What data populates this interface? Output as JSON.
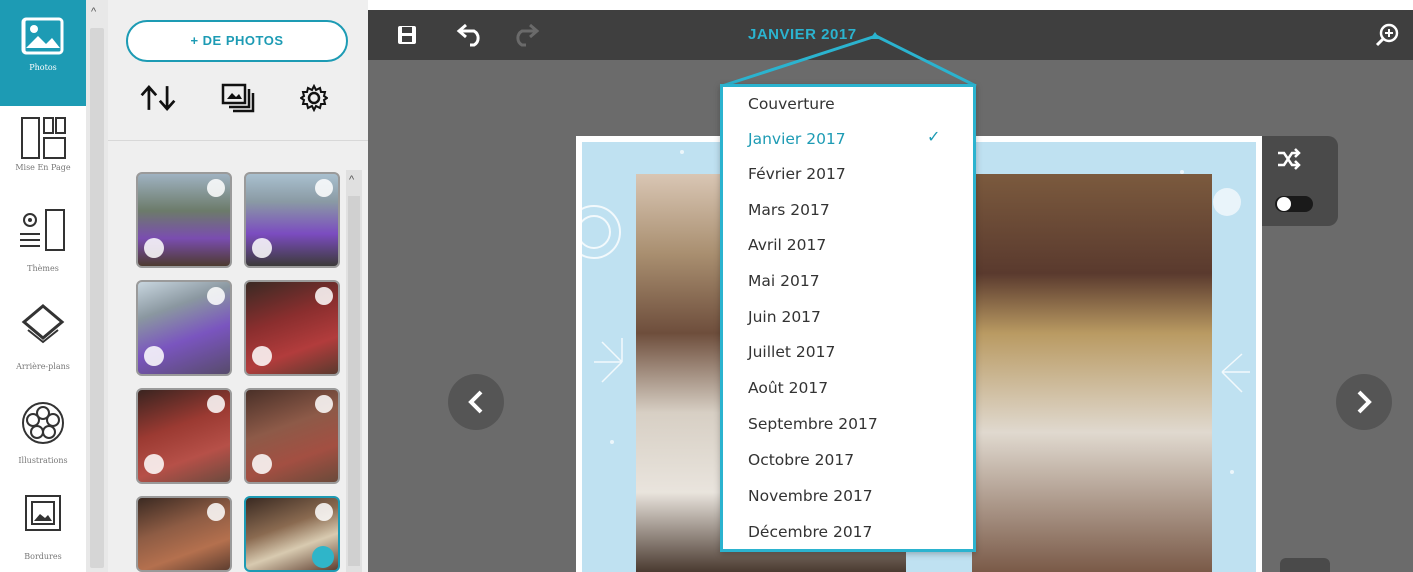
{
  "rail": {
    "tools": [
      {
        "label": "Photos",
        "icon": "image-icon"
      },
      {
        "label": "Mise En Page",
        "icon": "layout-icon"
      },
      {
        "label": "Thèmes",
        "icon": "themes-icon"
      },
      {
        "label": "Arrière-plans",
        "icon": "background-icon"
      },
      {
        "label": "Illustrations",
        "icon": "flower-icon"
      },
      {
        "label": "Bordures",
        "icon": "frame-icon"
      }
    ]
  },
  "panel": {
    "add_photos_label": "+ DE PHOTOS",
    "tools": [
      "sort-arrows-icon",
      "photo-stack-icon",
      "gear-icon"
    ]
  },
  "toolbar": {
    "page_title": "JANVIER 2017",
    "icons": [
      "save-icon",
      "undo-icon",
      "redo-icon",
      "zoom-icon"
    ]
  },
  "dropdown": {
    "items": [
      "Couverture",
      "Janvier 2017",
      "Février 2017",
      "Mars 2017",
      "Avril 2017",
      "Mai 2017",
      "Juin 2017",
      "Juillet 2017",
      "Août 2017",
      "Septembre 2017",
      "Octobre 2017",
      "Novembre 2017",
      "Décembre 2017"
    ],
    "selected_index": 1,
    "check_glyph": "✓"
  },
  "side_panel": {
    "icons": [
      "shuffle-icon",
      "toggle-switch-icon"
    ]
  },
  "colors": {
    "accent": "#1d9bb4",
    "title": "#2bb3cf",
    "toolbar": "#3f3f3f",
    "canvas": "#6b6b6b"
  }
}
